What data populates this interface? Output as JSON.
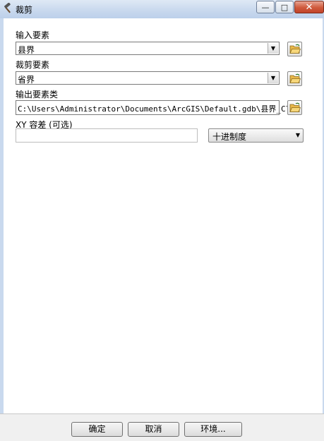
{
  "window": {
    "title": "裁剪",
    "minimize_glyph": "—",
    "maximize_glyph": "□",
    "close_glyph": "✕"
  },
  "form": {
    "input_features": {
      "label": "输入要素",
      "value": "县界"
    },
    "clip_features": {
      "label": "裁剪要素",
      "value": "省界"
    },
    "output_feature_class": {
      "label": "输出要素类",
      "value": "C:\\Users\\Administrator\\Documents\\ArcGIS\\Default.gdb\\县界_Clip"
    },
    "xy_tolerance": {
      "label": "XY 容差 (可选)",
      "value": "",
      "unit": "十进制度"
    }
  },
  "buttons": {
    "ok": "确定",
    "cancel": "取消",
    "environments": "环境..."
  },
  "icons": {
    "title": "hammer-icon",
    "browse": "open-folder-icon"
  }
}
